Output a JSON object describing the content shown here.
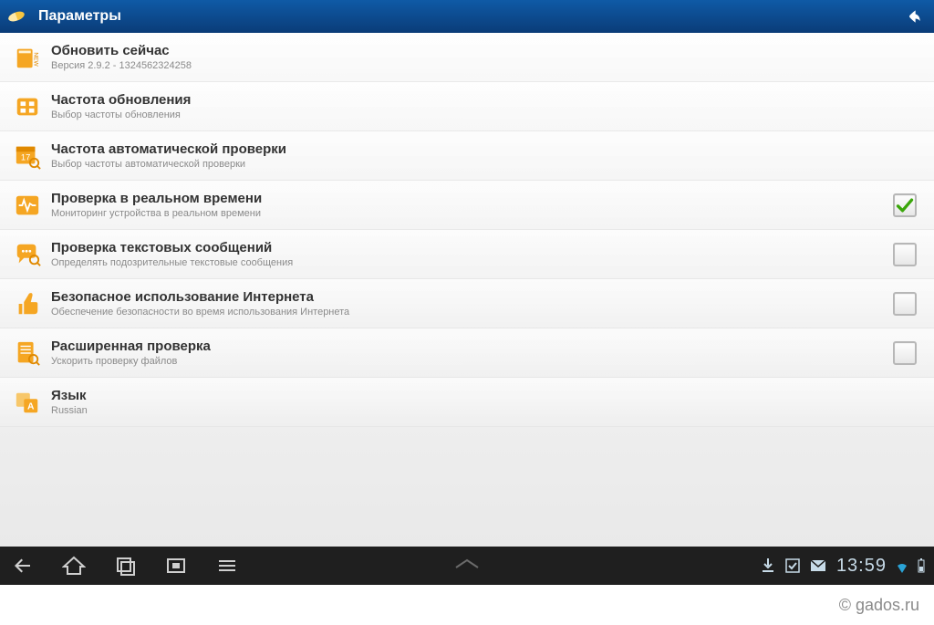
{
  "header": {
    "title": "Параметры"
  },
  "rows": [
    {
      "title": "Обновить сейчас",
      "sub": "Версия 2.9.2 - 1324562324258"
    },
    {
      "title": "Частота обновления",
      "sub": "Выбор частоты обновления"
    },
    {
      "title": "Частота автоматической проверки",
      "sub": "Выбор частоты автоматической проверки"
    },
    {
      "title": "Проверка в реальном времени",
      "sub": "Мониторинг устройства в реальном времени",
      "checked": true
    },
    {
      "title": "Проверка текстовых сообщений",
      "sub": "Определять подозрительные текстовые сообщения",
      "checked": false
    },
    {
      "title": "Безопасное использование Интернета",
      "sub": "Обеспечение безопасности во время использования Интернета",
      "checked": false
    },
    {
      "title": "Расширенная проверка",
      "sub": "Ускорить проверку файлов",
      "checked": false
    },
    {
      "title": "Язык",
      "sub": "Russian"
    }
  ],
  "statusbar": {
    "time": "13:59"
  },
  "footer": {
    "watermark": "© gados.ru"
  }
}
